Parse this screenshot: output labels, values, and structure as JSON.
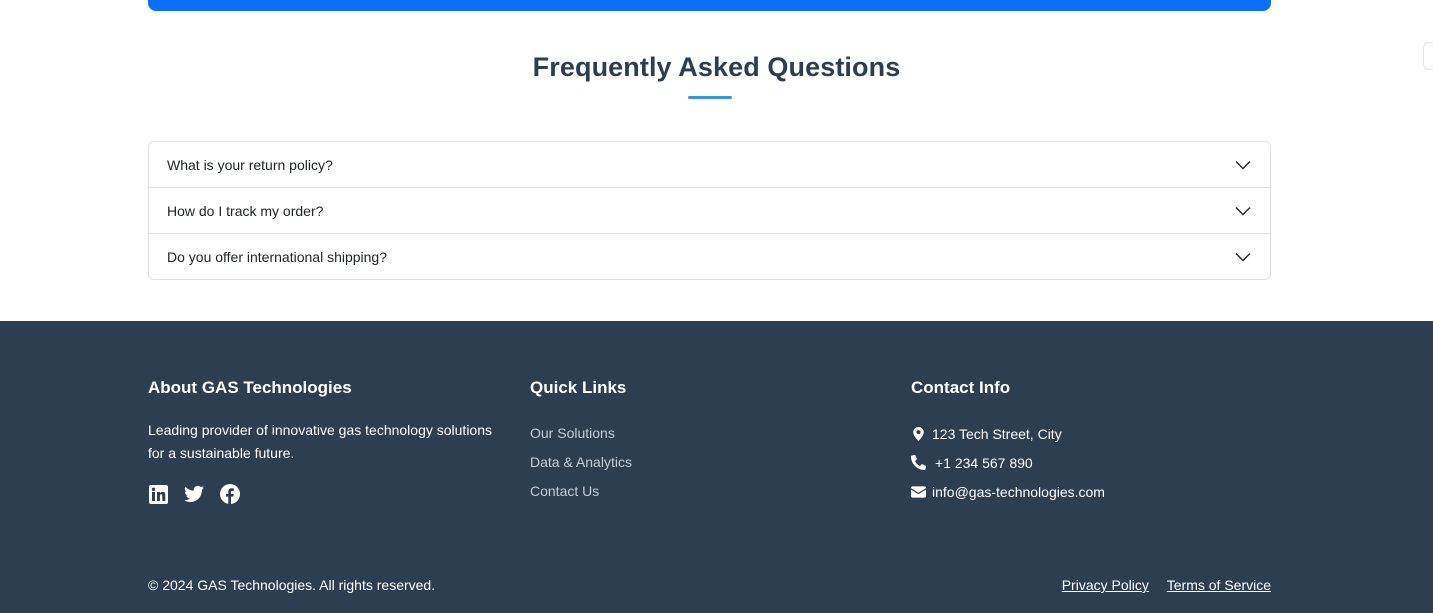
{
  "faq": {
    "title": "Frequently Asked Questions",
    "items": [
      {
        "question": "What is your return policy?"
      },
      {
        "question": "How do I track my order?"
      },
      {
        "question": "Do you offer international shipping?"
      }
    ]
  },
  "footer": {
    "about": {
      "heading": "About GAS Technologies",
      "text": "Leading provider of innovative gas technology solutions for a sustainable future.",
      "social_icons": [
        "linkedin-icon",
        "twitter-icon",
        "facebook-icon"
      ]
    },
    "quick_links": {
      "heading": "Quick Links",
      "links": [
        "Our Solutions",
        "Data & Analytics",
        "Contact Us"
      ]
    },
    "contact": {
      "heading": "Contact Info",
      "address": "123 Tech Street, City",
      "phone": "+1 234 567 890",
      "email": "info@gas-technologies.com"
    },
    "copyright": "© 2024 GAS Technologies. All rights reserved.",
    "legal_links": [
      "Privacy Policy",
      "Terms of Service"
    ]
  },
  "colors": {
    "accent_blue": "#0d6efd",
    "underline_blue": "#3498db",
    "footer_bg": "#2c3e50",
    "heading_text": "#2c3e50"
  }
}
